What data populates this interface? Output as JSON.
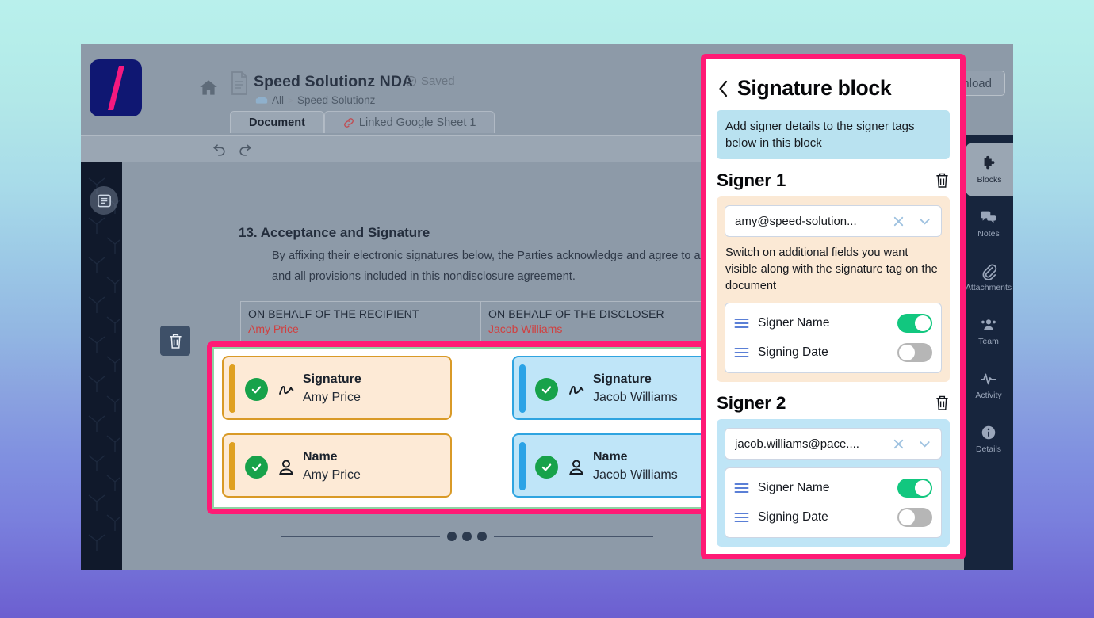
{
  "app": {
    "logo_alt": "brand-logo",
    "document_title": "Speed Solutionz NDA",
    "saved_label": "Saved",
    "breadcrumb": {
      "root": "All",
      "separator": ">",
      "current": "Speed Solutionz"
    },
    "tabs": [
      {
        "label": "Document",
        "active": true
      },
      {
        "label": "Linked Google Sheet 1",
        "active": false
      }
    ],
    "download_label": "Download"
  },
  "document": {
    "section_heading": "13. Acceptance and Signature",
    "section_paragraph": "By affixing their electronic signatures below, the Parties acknowledge and agree to any and all provisions included in this nondisclosure agreement.",
    "behalf": [
      {
        "label": "ON BEHALF OF THE RECIPIENT",
        "name": "Amy Price"
      },
      {
        "label": "ON BEHALF OF THE DISCLOSER",
        "name": "Jacob Williams"
      }
    ],
    "signature_tags": [
      {
        "kind": "signature",
        "label": "Signature",
        "value": "Amy Price",
        "theme": "amber"
      },
      {
        "kind": "name",
        "label": "Name",
        "value": "Amy Price",
        "theme": "amber"
      },
      {
        "kind": "signature",
        "label": "Signature",
        "value": "Jacob Williams",
        "theme": "blue"
      },
      {
        "kind": "name",
        "label": "Name",
        "value": "Jacob Williams",
        "theme": "blue"
      }
    ]
  },
  "right_rail": [
    {
      "label": "Blocks",
      "icon": "puzzle-icon",
      "active": true
    },
    {
      "label": "Notes",
      "icon": "chat-icon",
      "active": false
    },
    {
      "label": "Attachments",
      "icon": "paperclip-icon",
      "active": false
    },
    {
      "label": "Team",
      "icon": "people-icon",
      "active": false
    },
    {
      "label": "Activity",
      "icon": "pulse-icon",
      "active": false
    },
    {
      "label": "Details",
      "icon": "info-icon",
      "active": false
    }
  ],
  "panel": {
    "back_icon": "chevron-left-icon",
    "title": "Signature block",
    "hint": "Add signer details to the signer tags below in this block",
    "field_note": "Switch on additional fields you want visible along with the signature tag on the document",
    "signers": [
      {
        "title": "Signer 1",
        "theme": "amber",
        "email": "amy@speed-solution...",
        "fields": [
          {
            "label": "Signer Name",
            "on": true
          },
          {
            "label": "Signing Date",
            "on": false
          }
        ]
      },
      {
        "title": "Signer 2",
        "theme": "blue",
        "email": "jacob.williams@pace....",
        "fields": [
          {
            "label": "Signer Name",
            "on": true
          },
          {
            "label": "Signing Date",
            "on": false
          }
        ]
      }
    ]
  },
  "colors": {
    "highlight_pink": "#ff1a75",
    "toggle_on_green": "#12c77f",
    "toggle_off_gray": "#b6b6b6",
    "amber_tag": "#fdead6",
    "blue_tag": "#bfe5f8",
    "check_green": "#17a24a",
    "brand_navy": "#0f1772",
    "brand_pink": "#f5197f"
  }
}
